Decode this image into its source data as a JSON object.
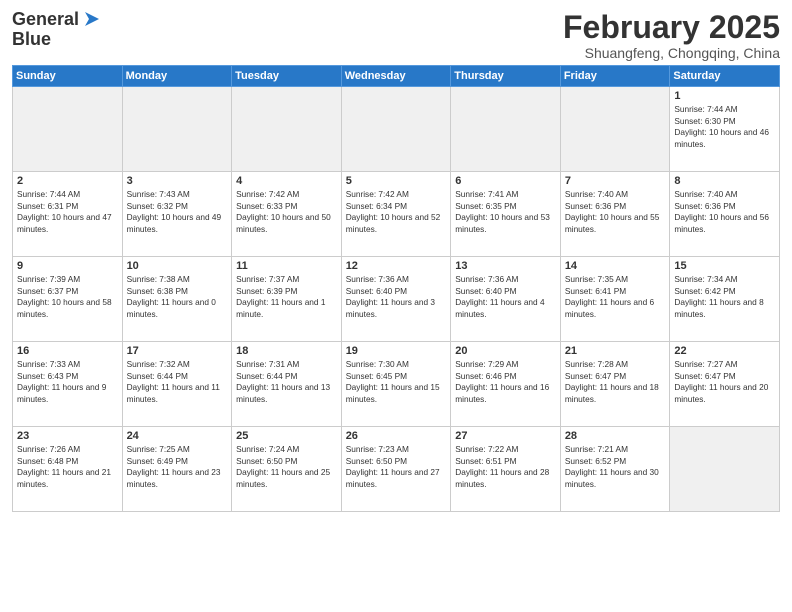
{
  "logo": {
    "line1": "General",
    "line2": "Blue"
  },
  "title": "February 2025",
  "subtitle": "Shuangfeng, Chongqing, China",
  "weekdays": [
    "Sunday",
    "Monday",
    "Tuesday",
    "Wednesday",
    "Thursday",
    "Friday",
    "Saturday"
  ],
  "weeks": [
    [
      {
        "day": "",
        "info": ""
      },
      {
        "day": "",
        "info": ""
      },
      {
        "day": "",
        "info": ""
      },
      {
        "day": "",
        "info": ""
      },
      {
        "day": "",
        "info": ""
      },
      {
        "day": "",
        "info": ""
      },
      {
        "day": "1",
        "info": "Sunrise: 7:44 AM\nSunset: 6:30 PM\nDaylight: 10 hours and 46 minutes."
      }
    ],
    [
      {
        "day": "2",
        "info": "Sunrise: 7:44 AM\nSunset: 6:31 PM\nDaylight: 10 hours and 47 minutes."
      },
      {
        "day": "3",
        "info": "Sunrise: 7:43 AM\nSunset: 6:32 PM\nDaylight: 10 hours and 49 minutes."
      },
      {
        "day": "4",
        "info": "Sunrise: 7:42 AM\nSunset: 6:33 PM\nDaylight: 10 hours and 50 minutes."
      },
      {
        "day": "5",
        "info": "Sunrise: 7:42 AM\nSunset: 6:34 PM\nDaylight: 10 hours and 52 minutes."
      },
      {
        "day": "6",
        "info": "Sunrise: 7:41 AM\nSunset: 6:35 PM\nDaylight: 10 hours and 53 minutes."
      },
      {
        "day": "7",
        "info": "Sunrise: 7:40 AM\nSunset: 6:36 PM\nDaylight: 10 hours and 55 minutes."
      },
      {
        "day": "8",
        "info": "Sunrise: 7:40 AM\nSunset: 6:36 PM\nDaylight: 10 hours and 56 minutes."
      }
    ],
    [
      {
        "day": "9",
        "info": "Sunrise: 7:39 AM\nSunset: 6:37 PM\nDaylight: 10 hours and 58 minutes."
      },
      {
        "day": "10",
        "info": "Sunrise: 7:38 AM\nSunset: 6:38 PM\nDaylight: 11 hours and 0 minutes."
      },
      {
        "day": "11",
        "info": "Sunrise: 7:37 AM\nSunset: 6:39 PM\nDaylight: 11 hours and 1 minute."
      },
      {
        "day": "12",
        "info": "Sunrise: 7:36 AM\nSunset: 6:40 PM\nDaylight: 11 hours and 3 minutes."
      },
      {
        "day": "13",
        "info": "Sunrise: 7:36 AM\nSunset: 6:40 PM\nDaylight: 11 hours and 4 minutes."
      },
      {
        "day": "14",
        "info": "Sunrise: 7:35 AM\nSunset: 6:41 PM\nDaylight: 11 hours and 6 minutes."
      },
      {
        "day": "15",
        "info": "Sunrise: 7:34 AM\nSunset: 6:42 PM\nDaylight: 11 hours and 8 minutes."
      }
    ],
    [
      {
        "day": "16",
        "info": "Sunrise: 7:33 AM\nSunset: 6:43 PM\nDaylight: 11 hours and 9 minutes."
      },
      {
        "day": "17",
        "info": "Sunrise: 7:32 AM\nSunset: 6:44 PM\nDaylight: 11 hours and 11 minutes."
      },
      {
        "day": "18",
        "info": "Sunrise: 7:31 AM\nSunset: 6:44 PM\nDaylight: 11 hours and 13 minutes."
      },
      {
        "day": "19",
        "info": "Sunrise: 7:30 AM\nSunset: 6:45 PM\nDaylight: 11 hours and 15 minutes."
      },
      {
        "day": "20",
        "info": "Sunrise: 7:29 AM\nSunset: 6:46 PM\nDaylight: 11 hours and 16 minutes."
      },
      {
        "day": "21",
        "info": "Sunrise: 7:28 AM\nSunset: 6:47 PM\nDaylight: 11 hours and 18 minutes."
      },
      {
        "day": "22",
        "info": "Sunrise: 7:27 AM\nSunset: 6:47 PM\nDaylight: 11 hours and 20 minutes."
      }
    ],
    [
      {
        "day": "23",
        "info": "Sunrise: 7:26 AM\nSunset: 6:48 PM\nDaylight: 11 hours and 21 minutes."
      },
      {
        "day": "24",
        "info": "Sunrise: 7:25 AM\nSunset: 6:49 PM\nDaylight: 11 hours and 23 minutes."
      },
      {
        "day": "25",
        "info": "Sunrise: 7:24 AM\nSunset: 6:50 PM\nDaylight: 11 hours and 25 minutes."
      },
      {
        "day": "26",
        "info": "Sunrise: 7:23 AM\nSunset: 6:50 PM\nDaylight: 11 hours and 27 minutes."
      },
      {
        "day": "27",
        "info": "Sunrise: 7:22 AM\nSunset: 6:51 PM\nDaylight: 11 hours and 28 minutes."
      },
      {
        "day": "28",
        "info": "Sunrise: 7:21 AM\nSunset: 6:52 PM\nDaylight: 11 hours and 30 minutes."
      },
      {
        "day": "",
        "info": ""
      }
    ]
  ]
}
